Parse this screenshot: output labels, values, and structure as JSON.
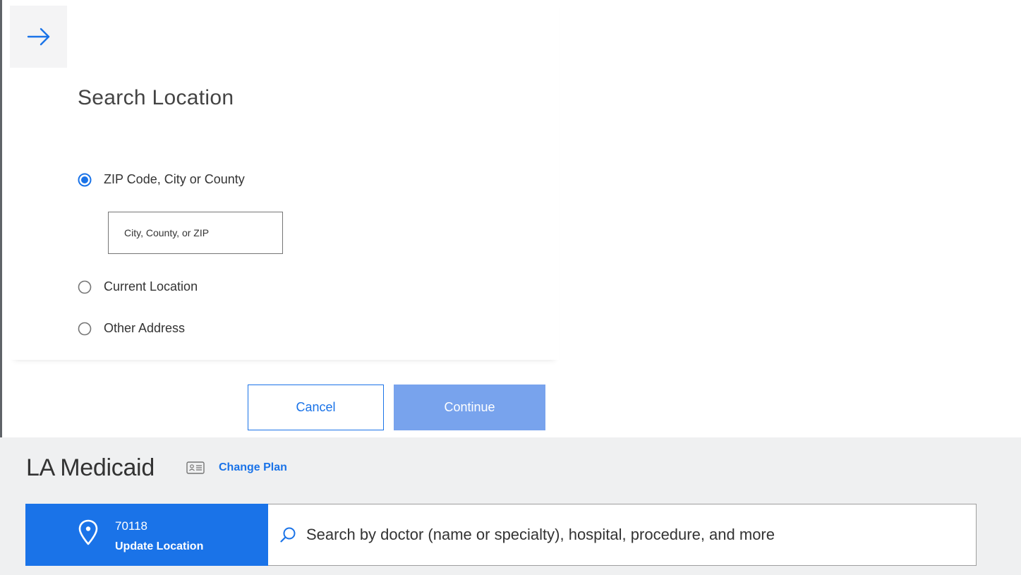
{
  "colors": {
    "accent": "#1a73e8",
    "continue_disabled": "#78a3ed",
    "bar_bg": "#eff0f1"
  },
  "dialog": {
    "back_icon": "arrow-right-icon",
    "title": "Search Location",
    "options": [
      {
        "label": "ZIP Code, City or County",
        "selected": true
      },
      {
        "label": "Current Location",
        "selected": false
      },
      {
        "label": "Other Address",
        "selected": false
      }
    ],
    "zip_input": {
      "value": "",
      "placeholder": "City, County, or ZIP"
    },
    "cancel_label": "Cancel",
    "continue_label": "Continue"
  },
  "plan": {
    "name": "LA Medicaid",
    "card_icon": "id-card-icon",
    "change_label": "Change Plan"
  },
  "location": {
    "icon": "map-pin-icon",
    "zip": "70118",
    "update_label": "Update Location"
  },
  "search": {
    "icon": "search-icon",
    "placeholder": "Search by doctor (name or specialty), hospital, procedure, and more"
  }
}
